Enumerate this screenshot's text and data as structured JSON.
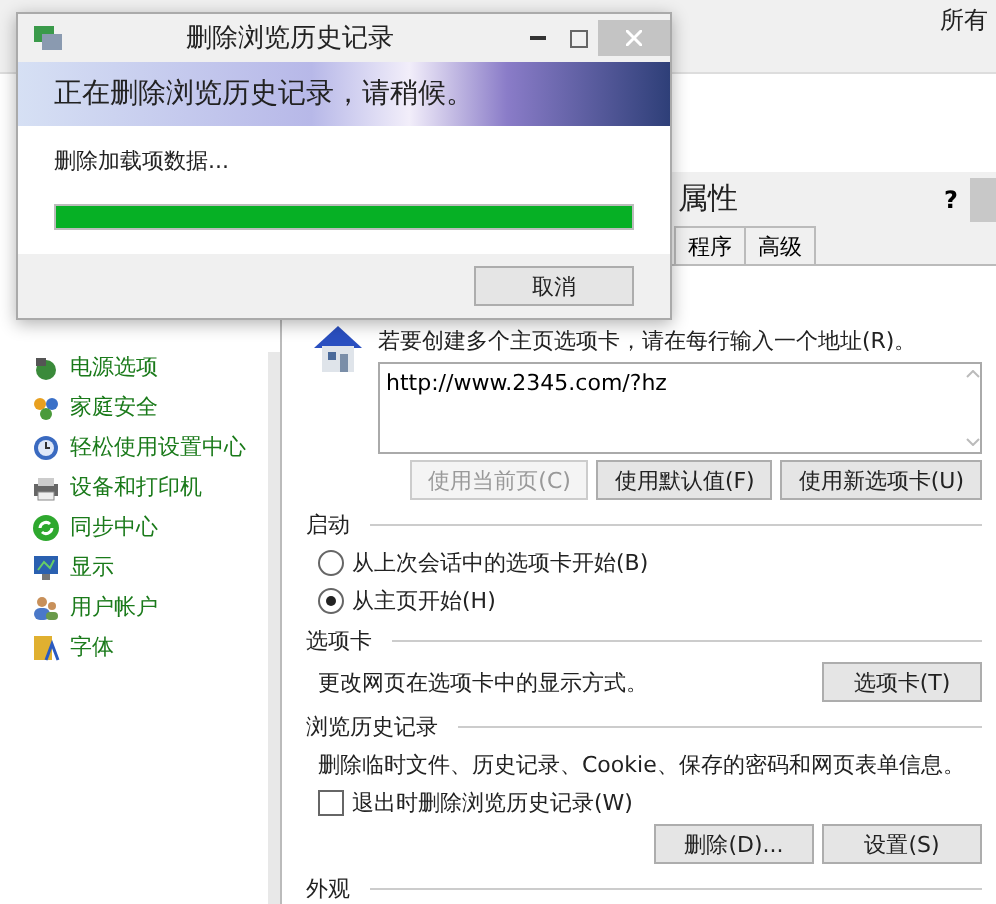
{
  "background_window": {
    "header_text": "所有",
    "sidebar_items": [
      {
        "label": "电源选项",
        "kind": "power"
      },
      {
        "label": "家庭安全",
        "kind": "family"
      },
      {
        "label": "轻松使用设置中心",
        "kind": "ease"
      },
      {
        "label": "设备和打印机",
        "kind": "printer"
      },
      {
        "label": "同步中心",
        "kind": "sync"
      },
      {
        "label": "显示",
        "kind": "display"
      },
      {
        "label": "用户帐户",
        "kind": "users"
      },
      {
        "label": "字体",
        "kind": "fonts"
      }
    ]
  },
  "properties_dialog": {
    "title": "属性",
    "help": "?",
    "tabs": [
      {
        "label": "程序",
        "selected": false
      },
      {
        "label": "高级",
        "selected": false
      }
    ],
    "home_page": {
      "instruction": "若要创建多个主页选项卡，请在每行输入一个地址(R)。",
      "value": "http://www.2345.com/?hz",
      "buttons": [
        {
          "label": "使用当前页(C)",
          "disabled": true
        },
        {
          "label": "使用默认值(F)",
          "disabled": false
        },
        {
          "label": "使用新选项卡(U)",
          "disabled": false
        }
      ]
    },
    "startup": {
      "heading": "启动",
      "options": [
        {
          "label": "从上次会话中的选项卡开始(B)",
          "selected": false
        },
        {
          "label": "从主页开始(H)",
          "selected": true
        }
      ]
    },
    "tabs_section": {
      "heading": "选项卡",
      "text": "更改网页在选项卡中的显示方式。",
      "button": "选项卡(T)"
    },
    "history": {
      "heading": "浏览历史记录",
      "text": "删除临时文件、历史记录、Cookie、保存的密码和网页表单信息。",
      "checkbox": {
        "label": "退出时删除浏览历史记录(W)",
        "checked": false
      },
      "buttons": [
        "删除(D)...",
        "设置(S)"
      ]
    },
    "appearance": {
      "heading": "外观"
    }
  },
  "progress_dialog": {
    "title": "删除浏览历史记录",
    "banner": "正在删除浏览历史记录，请稍候。",
    "status": "删除加载项数据...",
    "level": 1,
    "button": "取消"
  }
}
